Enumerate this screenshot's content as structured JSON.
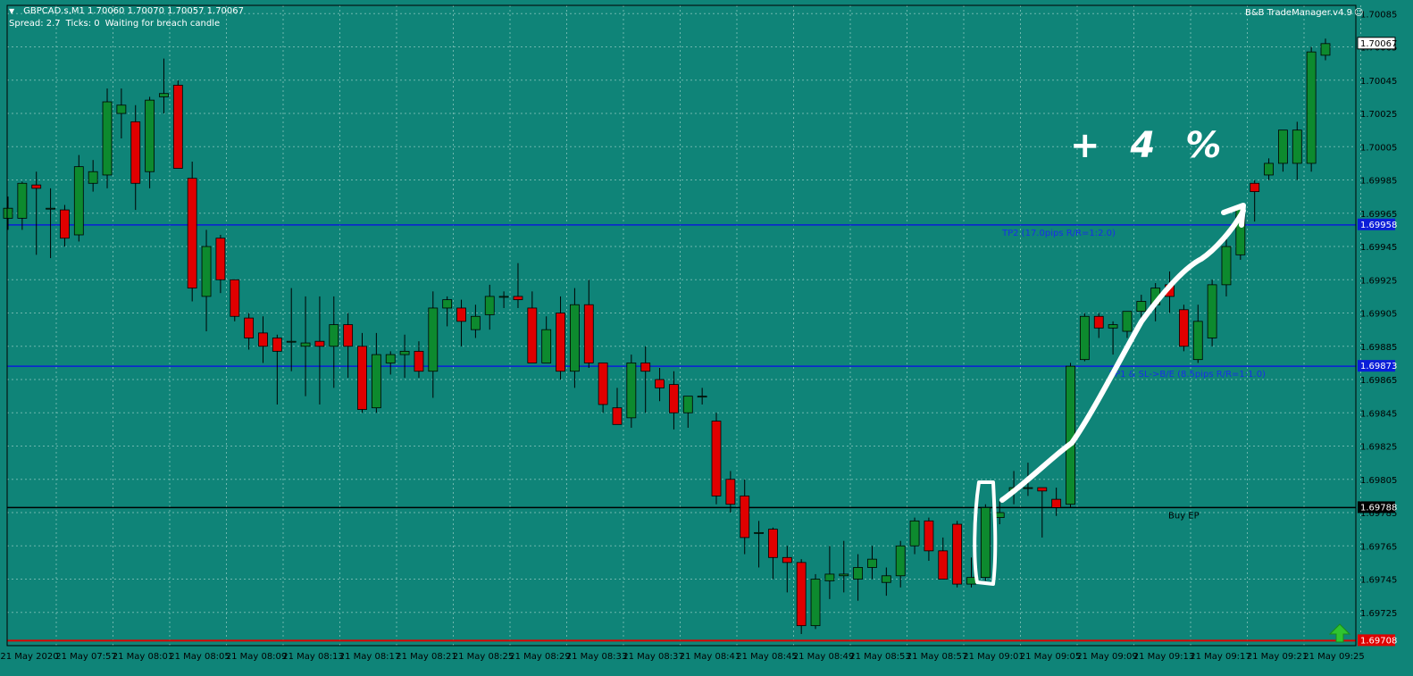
{
  "header": {
    "symbol_ohlc": "GBPCAD.s,M1  1.70060 1.70070 1.70057 1.70067",
    "spread": "Spread: 2.7",
    "ticks": "Ticks: 0",
    "status": "Waiting for breach candle"
  },
  "trade_manager": {
    "label": "B&B TradeManager.v4.9"
  },
  "annotation": {
    "text": "+ 4 %"
  },
  "colors": {
    "background": "#0f8478",
    "bull": "#0d8a2e",
    "bear": "#e00000",
    "grid": "#6fb7ae",
    "tp_line": "#0b1ed8",
    "entry_line": "#000000",
    "stop_line": "#e00000",
    "annotation": "#ffffff"
  },
  "icons": {
    "corner_arrow": "up-arrow-icon",
    "smiley": "smiley-icon"
  },
  "chart_data": {
    "type": "candlestick",
    "symbol": "GBPCAD.s",
    "timeframe": "M1",
    "ylim": [
      1.69705,
      1.7009
    ],
    "y_ticks": [
      "1.70085",
      "1.70065",
      "1.70045",
      "1.70025",
      "1.70005",
      "1.69985",
      "1.69965",
      "1.69945",
      "1.69925",
      "1.69905",
      "1.69885",
      "1.69865",
      "1.69845",
      "1.69825",
      "1.69805",
      "1.69785",
      "1.69765",
      "1.69745",
      "1.69725"
    ],
    "x_ticks": [
      "21 May 2020",
      "21 May 07:57",
      "21 May 08:01",
      "21 May 08:05",
      "21 May 08:09",
      "21 May 08:13",
      "21 May 08:17",
      "21 May 08:21",
      "21 May 08:25",
      "21 May 08:29",
      "21 May 08:33",
      "21 May 08:37",
      "21 May 08:41",
      "21 May 08:45",
      "21 May 08:49",
      "21 May 08:53",
      "21 May 08:57",
      "21 May 09:01",
      "21 May 09:05",
      "21 May 09:09",
      "21 May 09:13",
      "21 May 09:17",
      "21 May 09:21",
      "21 May 09:25"
    ],
    "current_price": "1.70067",
    "levels": [
      {
        "name": "tp2",
        "price": 1.69958,
        "price_label": "1.69958",
        "text": "TP2 (17.0pips R/R=1:2.0)",
        "color": "#0b1ed8"
      },
      {
        "name": "tp1",
        "price": 1.69873,
        "price_label": "1.69873",
        "text": "TP1 & SL->B/E (8.5pips R/R=1:1.0)",
        "color": "#0b1ed8"
      },
      {
        "name": "buy-ep",
        "price": 1.69788,
        "price_label": "1.69788",
        "text": "Buy EP",
        "color": "#000000"
      },
      {
        "name": "stop",
        "price": 1.69708,
        "price_label": "1.69708",
        "text": "",
        "color": "#e00000"
      }
    ],
    "candles": [
      {
        "o": 1.69962,
        "h": 1.69975,
        "l": 1.69955,
        "c": 1.69968
      },
      {
        "o": 1.69962,
        "h": 1.69984,
        "l": 1.69955,
        "c": 1.69983
      },
      {
        "o": 1.69982,
        "h": 1.6999,
        "l": 1.6994,
        "c": 1.6998
      },
      {
        "o": 1.69968,
        "h": 1.6998,
        "l": 1.69938,
        "c": 1.69968
      },
      {
        "o": 1.69967,
        "h": 1.6997,
        "l": 1.69945,
        "c": 1.6995
      },
      {
        "o": 1.69952,
        "h": 1.7,
        "l": 1.69948,
        "c": 1.69993
      },
      {
        "o": 1.69983,
        "h": 1.69997,
        "l": 1.69978,
        "c": 1.6999
      },
      {
        "o": 1.69988,
        "h": 1.7004,
        "l": 1.6998,
        "c": 1.70032
      },
      {
        "o": 1.70025,
        "h": 1.7004,
        "l": 1.7001,
        "c": 1.7003
      },
      {
        "o": 1.7002,
        "h": 1.7003,
        "l": 1.69967,
        "c": 1.69983
      },
      {
        "o": 1.6999,
        "h": 1.70035,
        "l": 1.6998,
        "c": 1.70033
      },
      {
        "o": 1.70035,
        "h": 1.70058,
        "l": 1.70025,
        "c": 1.70037
      },
      {
        "o": 1.70042,
        "h": 1.70045,
        "l": 1.69992,
        "c": 1.69992
      },
      {
        "o": 1.69986,
        "h": 1.69996,
        "l": 1.69912,
        "c": 1.6992
      },
      {
        "o": 1.69915,
        "h": 1.69955,
        "l": 1.69894,
        "c": 1.69945
      },
      {
        "o": 1.6995,
        "h": 1.69952,
        "l": 1.69917,
        "c": 1.69925
      },
      {
        "o": 1.69925,
        "h": 1.69925,
        "l": 1.699,
        "c": 1.69903
      },
      {
        "o": 1.69902,
        "h": 1.69905,
        "l": 1.69883,
        "c": 1.6989
      },
      {
        "o": 1.69893,
        "h": 1.69903,
        "l": 1.69875,
        "c": 1.69885
      },
      {
        "o": 1.6989,
        "h": 1.69892,
        "l": 1.6985,
        "c": 1.69882
      },
      {
        "o": 1.69888,
        "h": 1.6992,
        "l": 1.6987,
        "c": 1.69888
      },
      {
        "o": 1.69885,
        "h": 1.69915,
        "l": 1.69855,
        "c": 1.69887
      },
      {
        "o": 1.69888,
        "h": 1.69915,
        "l": 1.6985,
        "c": 1.69885
      },
      {
        "o": 1.69885,
        "h": 1.69915,
        "l": 1.6986,
        "c": 1.69898
      },
      {
        "o": 1.69898,
        "h": 1.69905,
        "l": 1.69866,
        "c": 1.69885
      },
      {
        "o": 1.69885,
        "h": 1.69893,
        "l": 1.69845,
        "c": 1.69847
      },
      {
        "o": 1.69848,
        "h": 1.69893,
        "l": 1.69845,
        "c": 1.6988
      },
      {
        "o": 1.69875,
        "h": 1.69882,
        "l": 1.69868,
        "c": 1.6988
      },
      {
        "o": 1.6988,
        "h": 1.69892,
        "l": 1.69866,
        "c": 1.69882
      },
      {
        "o": 1.69882,
        "h": 1.69888,
        "l": 1.69866,
        "c": 1.6987
      },
      {
        "o": 1.6987,
        "h": 1.69918,
        "l": 1.69854,
        "c": 1.69908
      },
      {
        "o": 1.69908,
        "h": 1.69915,
        "l": 1.69897,
        "c": 1.69913
      },
      {
        "o": 1.69908,
        "h": 1.69913,
        "l": 1.69885,
        "c": 1.699
      },
      {
        "o": 1.69895,
        "h": 1.6991,
        "l": 1.6989,
        "c": 1.69903
      },
      {
        "o": 1.69904,
        "h": 1.69922,
        "l": 1.69895,
        "c": 1.69915
      },
      {
        "o": 1.69915,
        "h": 1.69918,
        "l": 1.69908,
        "c": 1.69915
      },
      {
        "o": 1.69915,
        "h": 1.69935,
        "l": 1.69908,
        "c": 1.69913
      },
      {
        "o": 1.69908,
        "h": 1.69918,
        "l": 1.69875,
        "c": 1.69875
      },
      {
        "o": 1.69875,
        "h": 1.69903,
        "l": 1.69875,
        "c": 1.69895
      },
      {
        "o": 1.69905,
        "h": 1.69915,
        "l": 1.69865,
        "c": 1.6987
      },
      {
        "o": 1.6987,
        "h": 1.6992,
        "l": 1.6986,
        "c": 1.6991
      },
      {
        "o": 1.6991,
        "h": 1.69925,
        "l": 1.69872,
        "c": 1.69875
      },
      {
        "o": 1.69875,
        "h": 1.69875,
        "l": 1.69845,
        "c": 1.6985
      },
      {
        "o": 1.69848,
        "h": 1.6986,
        "l": 1.69838,
        "c": 1.69838
      },
      {
        "o": 1.69842,
        "h": 1.6988,
        "l": 1.69836,
        "c": 1.69875
      },
      {
        "o": 1.69875,
        "h": 1.69885,
        "l": 1.69845,
        "c": 1.6987
      },
      {
        "o": 1.69865,
        "h": 1.69872,
        "l": 1.69852,
        "c": 1.6986
      },
      {
        "o": 1.69862,
        "h": 1.6987,
        "l": 1.69835,
        "c": 1.69845
      },
      {
        "o": 1.69845,
        "h": 1.69854,
        "l": 1.69836,
        "c": 1.69855
      },
      {
        "o": 1.69855,
        "h": 1.6986,
        "l": 1.6985,
        "c": 1.69855
      },
      {
        "o": 1.6984,
        "h": 1.69845,
        "l": 1.6979,
        "c": 1.69795
      },
      {
        "o": 1.69805,
        "h": 1.6981,
        "l": 1.69785,
        "c": 1.6979
      },
      {
        "o": 1.69795,
        "h": 1.69805,
        "l": 1.6976,
        "c": 1.6977
      },
      {
        "o": 1.69773,
        "h": 1.6978,
        "l": 1.69752,
        "c": 1.69773
      },
      {
        "o": 1.69775,
        "h": 1.69776,
        "l": 1.69745,
        "c": 1.69758
      },
      {
        "o": 1.69758,
        "h": 1.69765,
        "l": 1.69737,
        "c": 1.69755
      },
      {
        "o": 1.69755,
        "h": 1.69757,
        "l": 1.69712,
        "c": 1.69717
      },
      {
        "o": 1.69717,
        "h": 1.69748,
        "l": 1.69715,
        "c": 1.69745
      },
      {
        "o": 1.69744,
        "h": 1.69765,
        "l": 1.69733,
        "c": 1.69748
      },
      {
        "o": 1.69747,
        "h": 1.69768,
        "l": 1.69737,
        "c": 1.69748
      },
      {
        "o": 1.69745,
        "h": 1.6976,
        "l": 1.69732,
        "c": 1.69752
      },
      {
        "o": 1.69752,
        "h": 1.69765,
        "l": 1.69745,
        "c": 1.69757
      },
      {
        "o": 1.69743,
        "h": 1.69752,
        "l": 1.69735,
        "c": 1.69747
      },
      {
        "o": 1.69747,
        "h": 1.69768,
        "l": 1.6974,
        "c": 1.69765
      },
      {
        "o": 1.69765,
        "h": 1.69782,
        "l": 1.6976,
        "c": 1.6978
      },
      {
        "o": 1.6978,
        "h": 1.69782,
        "l": 1.69756,
        "c": 1.69762
      },
      {
        "o": 1.69762,
        "h": 1.6977,
        "l": 1.69745,
        "c": 1.69745
      },
      {
        "o": 1.69778,
        "h": 1.6978,
        "l": 1.6974,
        "c": 1.69742
      },
      {
        "o": 1.69742,
        "h": 1.69758,
        "l": 1.6974,
        "c": 1.69746
      },
      {
        "o": 1.69746,
        "h": 1.6979,
        "l": 1.69744,
        "c": 1.69788
      },
      {
        "o": 1.69782,
        "h": 1.69792,
        "l": 1.69778,
        "c": 1.69785
      },
      {
        "o": 1.69798,
        "h": 1.6981,
        "l": 1.6979,
        "c": 1.698
      },
      {
        "o": 1.698,
        "h": 1.69815,
        "l": 1.69795,
        "c": 1.698
      },
      {
        "o": 1.698,
        "h": 1.698,
        "l": 1.6977,
        "c": 1.69798
      },
      {
        "o": 1.69793,
        "h": 1.698,
        "l": 1.69783,
        "c": 1.69788
      },
      {
        "o": 1.6979,
        "h": 1.69875,
        "l": 1.69788,
        "c": 1.69873
      },
      {
        "o": 1.69877,
        "h": 1.69905,
        "l": 1.69876,
        "c": 1.69903
      },
      {
        "o": 1.69903,
        "h": 1.69905,
        "l": 1.6989,
        "c": 1.69896
      },
      {
        "o": 1.69896,
        "h": 1.699,
        "l": 1.6988,
        "c": 1.69898
      },
      {
        "o": 1.69894,
        "h": 1.69905,
        "l": 1.6989,
        "c": 1.69906
      },
      {
        "o": 1.69906,
        "h": 1.69916,
        "l": 1.69898,
        "c": 1.69912
      },
      {
        "o": 1.6991,
        "h": 1.69923,
        "l": 1.699,
        "c": 1.6992
      },
      {
        "o": 1.69922,
        "h": 1.6993,
        "l": 1.69905,
        "c": 1.69915
      },
      {
        "o": 1.69907,
        "h": 1.6991,
        "l": 1.69882,
        "c": 1.69885
      },
      {
        "o": 1.69877,
        "h": 1.6991,
        "l": 1.69875,
        "c": 1.699
      },
      {
        "o": 1.6989,
        "h": 1.69925,
        "l": 1.69885,
        "c": 1.69922
      },
      {
        "o": 1.69922,
        "h": 1.6995,
        "l": 1.69915,
        "c": 1.69945
      },
      {
        "o": 1.6994,
        "h": 1.6997,
        "l": 1.69937,
        "c": 1.69968
      },
      {
        "o": 1.69983,
        "h": 1.69985,
        "l": 1.6996,
        "c": 1.69978
      },
      {
        "o": 1.69988,
        "h": 1.69998,
        "l": 1.69985,
        "c": 1.69995
      },
      {
        "o": 1.69995,
        "h": 1.70015,
        "l": 1.6999,
        "c": 1.70015
      },
      {
        "o": 1.69995,
        "h": 1.7002,
        "l": 1.69985,
        "c": 1.70015
      },
      {
        "o": 1.69995,
        "h": 1.70065,
        "l": 1.6999,
        "c": 1.70062
      },
      {
        "o": 1.7006,
        "h": 1.7007,
        "l": 1.70057,
        "c": 1.70067
      }
    ]
  }
}
